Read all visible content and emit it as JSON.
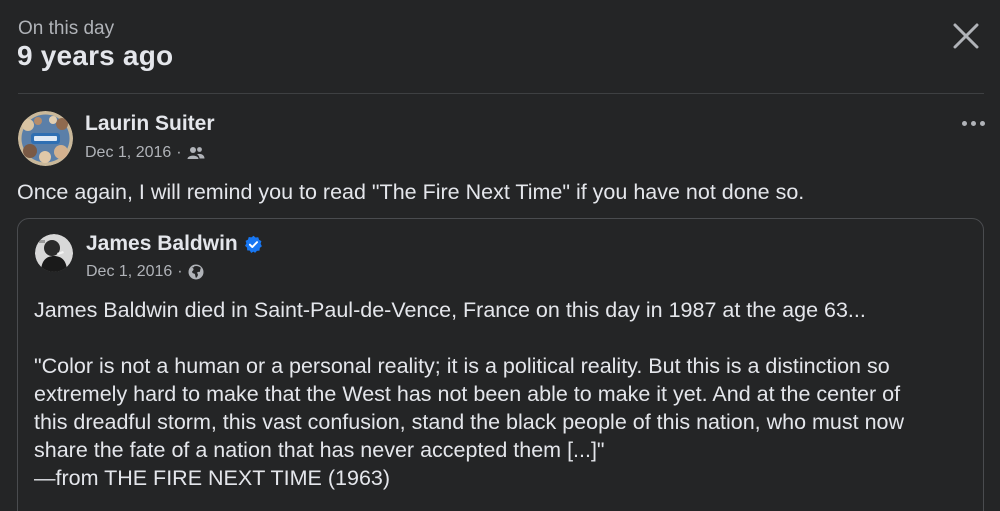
{
  "memory": {
    "eyebrow": "On this day",
    "title": "9 years ago"
  },
  "post": {
    "author": "Laurin Suiter",
    "date": "Dec 1, 2016",
    "separator": "·",
    "audience_icon": "friends-icon",
    "text": "Once again, I will remind you to read \"The Fire Next Time\" if you have not done so."
  },
  "shared_post": {
    "author": "James Baldwin",
    "verified": true,
    "date": "Dec 1, 2016",
    "separator": "·",
    "audience_icon": "globe-icon",
    "lead": "James Baldwin died in Saint-Paul-de-Vence, France on this day in 1987 at the age 63...",
    "quote_lines": [
      "\"Color is not a human or a personal reality; it is a political reality. But this is a distinction so",
      "extremely hard to make that the West has not been able to make it yet. And at the center of",
      "this dreadful storm, this vast confusion, stand the black people of this nation, who must now",
      "share the fate of a nation that has never accepted them [...]\"",
      "—from THE FIRE NEXT TIME (1963)"
    ]
  },
  "icons": {
    "close": "close-icon",
    "more": "more-options-icon",
    "verified": "verified-badge-icon"
  },
  "colors": {
    "background": "#242526",
    "primary_text": "#e4e6eb",
    "secondary_text": "#b0b3b8",
    "verified_blue": "#1877f2"
  }
}
